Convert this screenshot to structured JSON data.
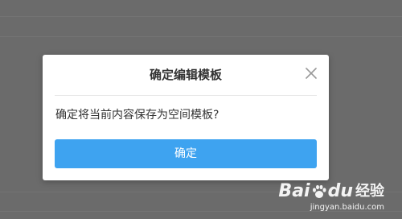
{
  "dialog": {
    "title": "确定编辑模板",
    "message": "确定将当前内容保存为空间模板?",
    "confirm_label": "确定"
  },
  "watermark": {
    "brand_left": "Bai",
    "brand_right": "du",
    "brand_suffix": "经验",
    "url": "jingyan.baidu.com"
  },
  "colors": {
    "overlay": "#6b6b6b",
    "dialog_bg": "#ffffff",
    "accent": "#3ea3f0",
    "text": "#333333"
  }
}
